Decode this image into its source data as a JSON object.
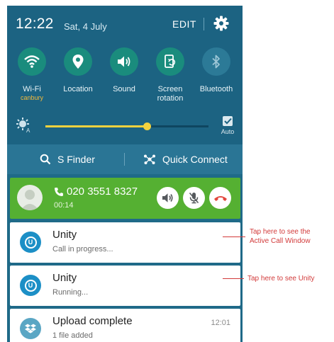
{
  "status_bar": {
    "time": "12:22",
    "date": "Sat, 4 July",
    "edit_label": "EDIT"
  },
  "quick_toggles": [
    {
      "label": "Wi-Fi",
      "sublabel": "canbury",
      "icon": "wifi-icon",
      "active": true
    },
    {
      "label": "Location",
      "sublabel": "",
      "icon": "location-pin-icon",
      "active": true
    },
    {
      "label": "Sound",
      "sublabel": "",
      "icon": "speaker-icon",
      "active": true
    },
    {
      "label": "Screen",
      "label2": "rotation",
      "sublabel": "",
      "icon": "screen-rotation-icon",
      "active": true
    },
    {
      "label": "Bluetooth",
      "sublabel": "",
      "icon": "bluetooth-icon",
      "active": false
    }
  ],
  "brightness": {
    "level": 0.62,
    "auto_label": "Auto",
    "auto_checked": true
  },
  "finder_bar": {
    "s_finder_label": "S Finder",
    "quick_connect_label": "Quick Connect"
  },
  "call": {
    "number": "020 3551 8327",
    "duration": "00:14"
  },
  "notifications": [
    {
      "title": "Unity",
      "subtitle": "Call in progress...",
      "time": "",
      "icon": "unity-icon"
    },
    {
      "title": "Unity",
      "subtitle": "Running...",
      "time": "",
      "icon": "unity-icon"
    },
    {
      "title": "Upload complete",
      "subtitle": "1 file added",
      "time": "12:01",
      "icon": "dropbox-icon"
    }
  ],
  "annotations": {
    "call_window_line1": "Tap here to see the",
    "call_window_line2": "Active Call Window",
    "unity": "Tap here to see Unity"
  },
  "colors": {
    "shade_background": "#1c6382",
    "toggle_active": "#1a8c7d",
    "call_card": "#55b032",
    "hangup_red": "#e2453c",
    "unity_blue": "#1c8fc6",
    "dropbox_teal": "#5aa6c4",
    "annotation_red": "#d23a3a"
  }
}
